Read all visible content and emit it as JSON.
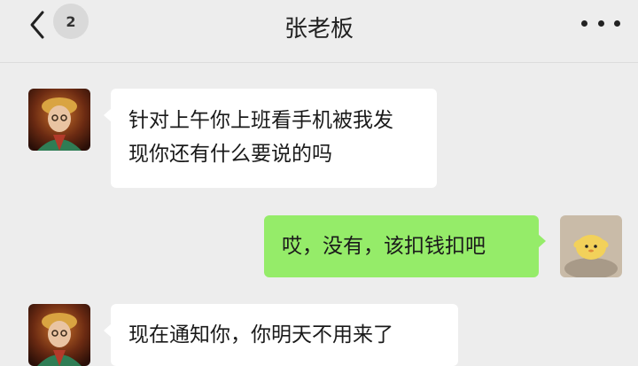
{
  "header": {
    "title": "张老板",
    "unread_count": "2",
    "back_icon": "chevron-left-icon",
    "more_icon": "more-dots-icon"
  },
  "colors": {
    "background": "#ededed",
    "incoming_bubble": "#ffffff",
    "outgoing_bubble": "#95ec69"
  },
  "messages": [
    {
      "direction": "incoming",
      "lines": [
        "针对上午你上班看手机被我发",
        "现你还有什么要说的吗"
      ]
    },
    {
      "direction": "outgoing",
      "lines": [
        "哎，没有，该扣钱扣吧"
      ]
    },
    {
      "direction": "incoming",
      "lines": [
        "现在通知你，你明天不用来了"
      ]
    }
  ]
}
